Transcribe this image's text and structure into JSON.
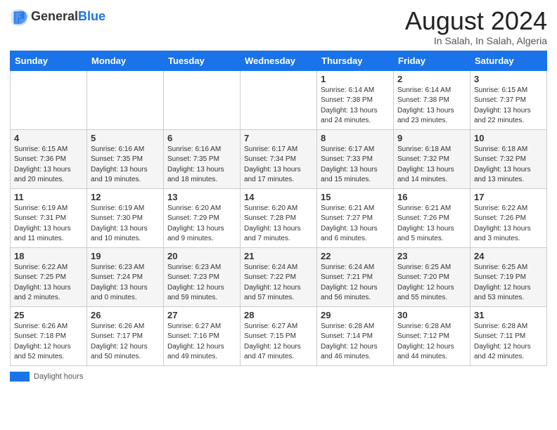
{
  "logo": {
    "general": "General",
    "blue": "Blue"
  },
  "header": {
    "month": "August 2024",
    "location": "In Salah, In Salah, Algeria"
  },
  "days_of_week": [
    "Sunday",
    "Monday",
    "Tuesday",
    "Wednesday",
    "Thursday",
    "Friday",
    "Saturday"
  ],
  "weeks": [
    [
      {
        "day": "",
        "info": ""
      },
      {
        "day": "",
        "info": ""
      },
      {
        "day": "",
        "info": ""
      },
      {
        "day": "",
        "info": ""
      },
      {
        "day": "1",
        "info": "Sunrise: 6:14 AM\nSunset: 7:38 PM\nDaylight: 13 hours\nand 24 minutes."
      },
      {
        "day": "2",
        "info": "Sunrise: 6:14 AM\nSunset: 7:38 PM\nDaylight: 13 hours\nand 23 minutes."
      },
      {
        "day": "3",
        "info": "Sunrise: 6:15 AM\nSunset: 7:37 PM\nDaylight: 13 hours\nand 22 minutes."
      }
    ],
    [
      {
        "day": "4",
        "info": "Sunrise: 6:15 AM\nSunset: 7:36 PM\nDaylight: 13 hours\nand 20 minutes."
      },
      {
        "day": "5",
        "info": "Sunrise: 6:16 AM\nSunset: 7:35 PM\nDaylight: 13 hours\nand 19 minutes."
      },
      {
        "day": "6",
        "info": "Sunrise: 6:16 AM\nSunset: 7:35 PM\nDaylight: 13 hours\nand 18 minutes."
      },
      {
        "day": "7",
        "info": "Sunrise: 6:17 AM\nSunset: 7:34 PM\nDaylight: 13 hours\nand 17 minutes."
      },
      {
        "day": "8",
        "info": "Sunrise: 6:17 AM\nSunset: 7:33 PM\nDaylight: 13 hours\nand 15 minutes."
      },
      {
        "day": "9",
        "info": "Sunrise: 6:18 AM\nSunset: 7:32 PM\nDaylight: 13 hours\nand 14 minutes."
      },
      {
        "day": "10",
        "info": "Sunrise: 6:18 AM\nSunset: 7:32 PM\nDaylight: 13 hours\nand 13 minutes."
      }
    ],
    [
      {
        "day": "11",
        "info": "Sunrise: 6:19 AM\nSunset: 7:31 PM\nDaylight: 13 hours\nand 11 minutes."
      },
      {
        "day": "12",
        "info": "Sunrise: 6:19 AM\nSunset: 7:30 PM\nDaylight: 13 hours\nand 10 minutes."
      },
      {
        "day": "13",
        "info": "Sunrise: 6:20 AM\nSunset: 7:29 PM\nDaylight: 13 hours\nand 9 minutes."
      },
      {
        "day": "14",
        "info": "Sunrise: 6:20 AM\nSunset: 7:28 PM\nDaylight: 13 hours\nand 7 minutes."
      },
      {
        "day": "15",
        "info": "Sunrise: 6:21 AM\nSunset: 7:27 PM\nDaylight: 13 hours\nand 6 minutes."
      },
      {
        "day": "16",
        "info": "Sunrise: 6:21 AM\nSunset: 7:26 PM\nDaylight: 13 hours\nand 5 minutes."
      },
      {
        "day": "17",
        "info": "Sunrise: 6:22 AM\nSunset: 7:26 PM\nDaylight: 13 hours\nand 3 minutes."
      }
    ],
    [
      {
        "day": "18",
        "info": "Sunrise: 6:22 AM\nSunset: 7:25 PM\nDaylight: 13 hours\nand 2 minutes."
      },
      {
        "day": "19",
        "info": "Sunrise: 6:23 AM\nSunset: 7:24 PM\nDaylight: 13 hours\nand 0 minutes."
      },
      {
        "day": "20",
        "info": "Sunrise: 6:23 AM\nSunset: 7:23 PM\nDaylight: 12 hours\nand 59 minutes."
      },
      {
        "day": "21",
        "info": "Sunrise: 6:24 AM\nSunset: 7:22 PM\nDaylight: 12 hours\nand 57 minutes."
      },
      {
        "day": "22",
        "info": "Sunrise: 6:24 AM\nSunset: 7:21 PM\nDaylight: 12 hours\nand 56 minutes."
      },
      {
        "day": "23",
        "info": "Sunrise: 6:25 AM\nSunset: 7:20 PM\nDaylight: 12 hours\nand 55 minutes."
      },
      {
        "day": "24",
        "info": "Sunrise: 6:25 AM\nSunset: 7:19 PM\nDaylight: 12 hours\nand 53 minutes."
      }
    ],
    [
      {
        "day": "25",
        "info": "Sunrise: 6:26 AM\nSunset: 7:18 PM\nDaylight: 12 hours\nand 52 minutes."
      },
      {
        "day": "26",
        "info": "Sunrise: 6:26 AM\nSunset: 7:17 PM\nDaylight: 12 hours\nand 50 minutes."
      },
      {
        "day": "27",
        "info": "Sunrise: 6:27 AM\nSunset: 7:16 PM\nDaylight: 12 hours\nand 49 minutes."
      },
      {
        "day": "28",
        "info": "Sunrise: 6:27 AM\nSunset: 7:15 PM\nDaylight: 12 hours\nand 47 minutes."
      },
      {
        "day": "29",
        "info": "Sunrise: 6:28 AM\nSunset: 7:14 PM\nDaylight: 12 hours\nand 46 minutes."
      },
      {
        "day": "30",
        "info": "Sunrise: 6:28 AM\nSunset: 7:12 PM\nDaylight: 12 hours\nand 44 minutes."
      },
      {
        "day": "31",
        "info": "Sunrise: 6:28 AM\nSunset: 7:11 PM\nDaylight: 12 hours\nand 42 minutes."
      }
    ]
  ],
  "footer": {
    "label": "Daylight hours"
  }
}
